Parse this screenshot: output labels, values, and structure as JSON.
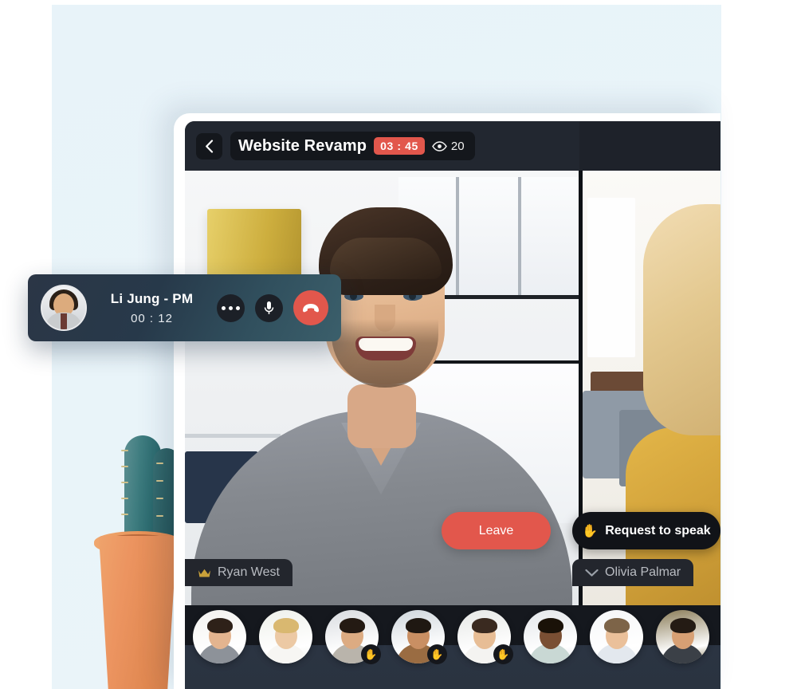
{
  "meeting": {
    "back_icon": "chevron-left-icon",
    "title": "Website Revamp",
    "timer": "03 : 45",
    "viewers_icon": "eye-icon",
    "viewers_count": "20",
    "accent_red": "#e2574c",
    "screen_bg": "#191c22",
    "topbar_bg": "#222730"
  },
  "stage": {
    "leave_label": "Leave",
    "request_label": "Request to speak",
    "request_icon": "raised-hand-icon",
    "speaker": {
      "name": "Ryan West",
      "icon": "crown-icon"
    },
    "second": {
      "name": "Olivia Palmar",
      "icon": "chevron-down-icon"
    }
  },
  "participants": [
    {
      "name": "participant-1",
      "hand_raised": false,
      "skin": "#e3b48f",
      "hair": "#2e2119",
      "shirt": "#8d9299",
      "bg": "#f3f2ef"
    },
    {
      "name": "participant-2",
      "hand_raised": false,
      "skin": "#ecc9a4",
      "hair": "#d9b870",
      "shirt": "#f7f6f3",
      "bg": "#eef0ea"
    },
    {
      "name": "participant-3",
      "hand_raised": true,
      "skin": "#dcab82",
      "hair": "#241a13",
      "shirt": "#b9b4ab",
      "bg": "#d9dce0"
    },
    {
      "name": "participant-4",
      "hand_raised": true,
      "skin": "#c98f63",
      "hair": "#1f1812",
      "shirt": "#9a6c42",
      "bg": "#cfd6dc"
    },
    {
      "name": "participant-5",
      "hand_raised": true,
      "skin": "#e7bd95",
      "hair": "#3a2a20",
      "shirt": "#f4f3f1",
      "bg": "#e6e8e6"
    },
    {
      "name": "participant-6",
      "hand_raised": false,
      "skin": "#7a4f33",
      "hair": "#1a1208",
      "shirt": "#c9d8d4",
      "bg": "#e4e7ea"
    },
    {
      "name": "participant-7",
      "hand_raised": false,
      "skin": "#eac09a",
      "hair": "#7d6448",
      "shirt": "#e3e8ee",
      "bg": "#f6f7f8"
    },
    {
      "name": "participant-8",
      "hand_raised": false,
      "skin": "#d7a074",
      "hair": "#241b14",
      "shirt": "#3b4047",
      "bg": "#8a7c58"
    }
  ],
  "call_widget": {
    "name": "Li Jung - PM",
    "duration": "00 : 12",
    "more_icon": "more-dots-icon",
    "mic_icon": "microphone-icon",
    "end_icon": "end-call-icon",
    "end_color": "#e2574c"
  },
  "decor": {
    "backdrop_color": "#e9f3f9",
    "plant": "cactus-in-terracotta-pot"
  }
}
